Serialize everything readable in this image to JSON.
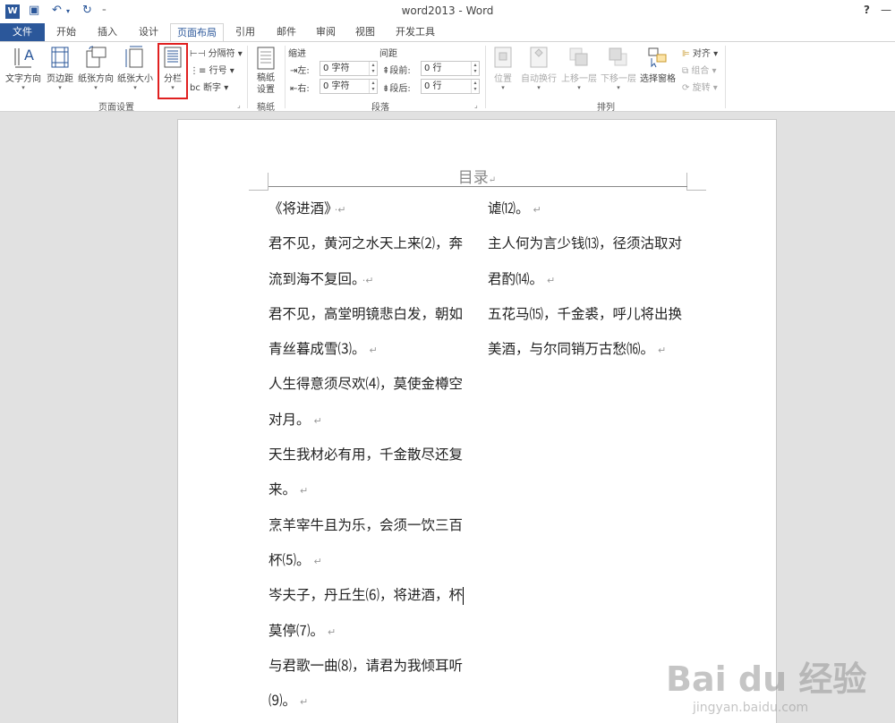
{
  "window": {
    "title": "word2013 - Word",
    "help": "?",
    "minimize": "—"
  },
  "tabs": [
    "文件",
    "开始",
    "插入",
    "设计",
    "页面布局",
    "引用",
    "邮件",
    "审阅",
    "视图",
    "开发工具"
  ],
  "active_tab": "页面布局",
  "ribbon": {
    "page_setup": {
      "text_direction": "文字方向",
      "margins": "页边距",
      "orientation": "纸张方向",
      "size": "纸张大小",
      "columns": "分栏",
      "breaks": "分隔符",
      "line_numbers": "行号",
      "hyphenation": "断字",
      "label": "页面设置"
    },
    "draft_paper": {
      "button": "稿纸\n设置",
      "label": "稿纸"
    },
    "paragraph": {
      "indent_header": "缩进",
      "spacing_header": "间距",
      "left_label": "左:",
      "right_label": "右:",
      "left_value": "0 字符",
      "right_value": "0 字符",
      "before_label": "段前:",
      "after_label": "段后:",
      "before_value": "0 行",
      "after_value": "0 行",
      "label": "段落"
    },
    "arrange": {
      "position": "位置",
      "wrap_text": "自动换行",
      "bring_forward": "上移一层",
      "send_backward": "下移一层",
      "selection_pane": "选择窗格",
      "align": "对齐",
      "group": "组合",
      "rotate": "旋转",
      "label": "排列"
    }
  },
  "document": {
    "heading": "目录",
    "left_column": [
      "《将进酒》",
      "君不见，黄河之水天上来⑵，奔",
      "流到海不复回。",
      "君不见，高堂明镜悲白发，朝如",
      "青丝暮成雪⑶。",
      "人生得意须尽欢⑷，莫使金樽空",
      "对月。",
      "天生我材必有用，千金散尽还复",
      "来。",
      "烹羊宰牛且为乐，会须一饮三百",
      "杯⑸。",
      "岑夫子，丹丘生⑹，将进酒，杯",
      "莫停⑺。",
      "与君歌一曲⑻，请君为我倾耳听",
      "⑼。"
    ],
    "right_column": [
      "谑⑿。",
      "主人何为言少钱⒀，径须沽取对",
      "君酌⒁。",
      "五花马⒂，千金裘，呼儿将出换",
      "美酒，与尔同销万古愁⒃。"
    ],
    "paragraph_mark": "↵",
    "heading_mark": "↵"
  },
  "watermark": {
    "brand": "Bai du 经验",
    "url": "jingyan.baidu.com"
  }
}
